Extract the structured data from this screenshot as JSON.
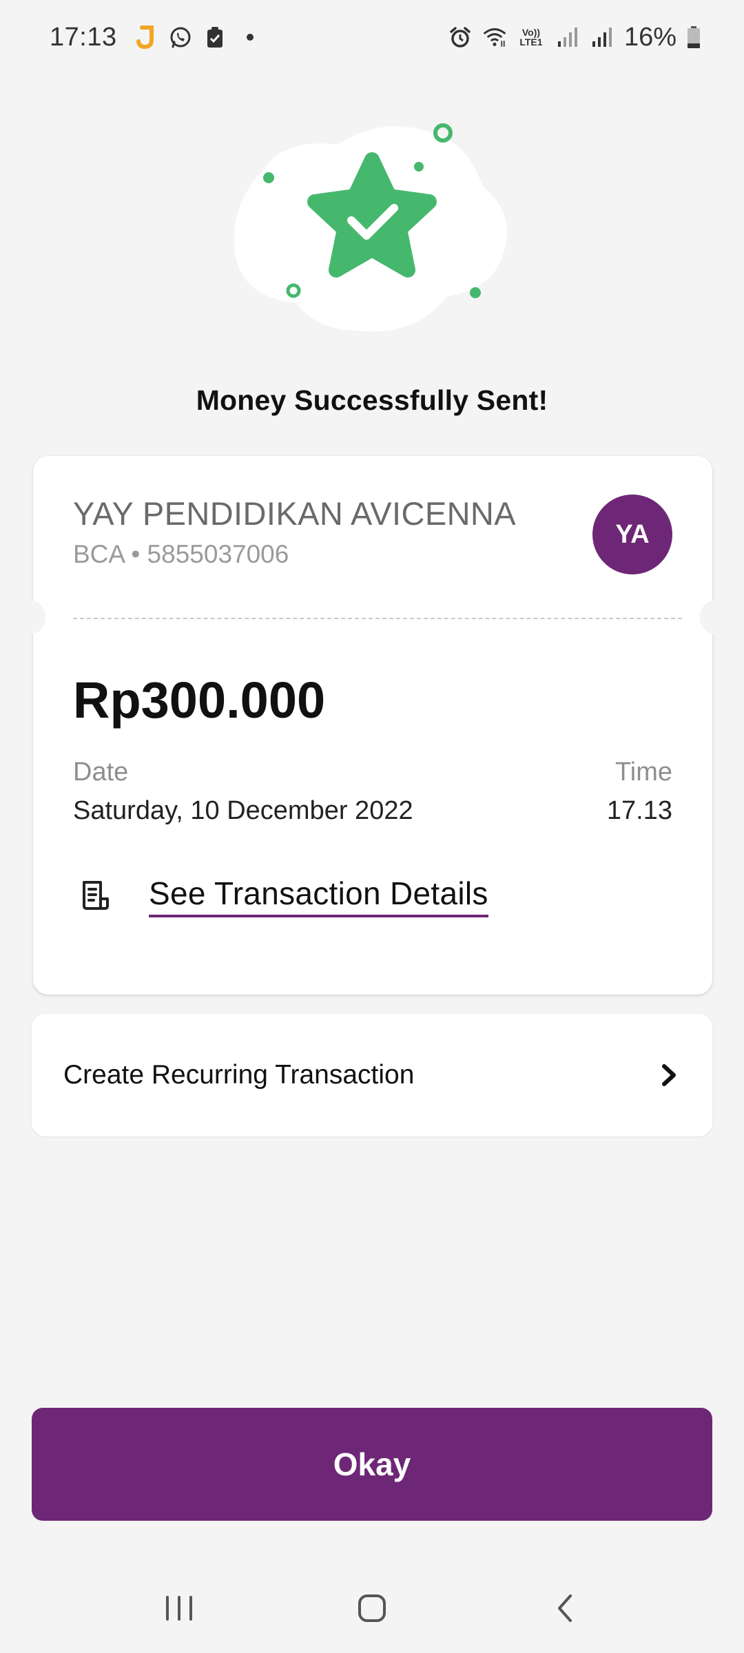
{
  "status_bar": {
    "time": "17:13",
    "battery_percent": "16%",
    "left_icons": [
      "jago-app-icon",
      "whatsapp-icon",
      "clipboard-icon",
      "notification-dot"
    ],
    "right_icons": [
      "alarm-icon",
      "wifi-icon",
      "volte-icon",
      "signal-icon",
      "signal-icon",
      "battery-icon"
    ],
    "volte_label_top": "Vo))",
    "volte_label_bottom": "LTE1"
  },
  "success": {
    "title": "Money Successfully Sent!",
    "accent_color": "#46b86d"
  },
  "receipt": {
    "recipient_name": "YAY PENDIDIKAN AVICENNA",
    "bank_account": "BCA • 5855037006",
    "avatar_initials": "YA",
    "avatar_color": "#6e2776",
    "amount": "Rp300.000",
    "date_label": "Date",
    "date_value": "Saturday, 10 December 2022",
    "time_label": "Time",
    "time_value": "17.13",
    "details_link": "See Transaction Details"
  },
  "recurring": {
    "label": "Create Recurring Transaction"
  },
  "actions": {
    "okay_label": "Okay",
    "primary_color": "#6e2776"
  },
  "nav_bar": {
    "buttons": [
      "recent-apps",
      "home",
      "back"
    ]
  }
}
